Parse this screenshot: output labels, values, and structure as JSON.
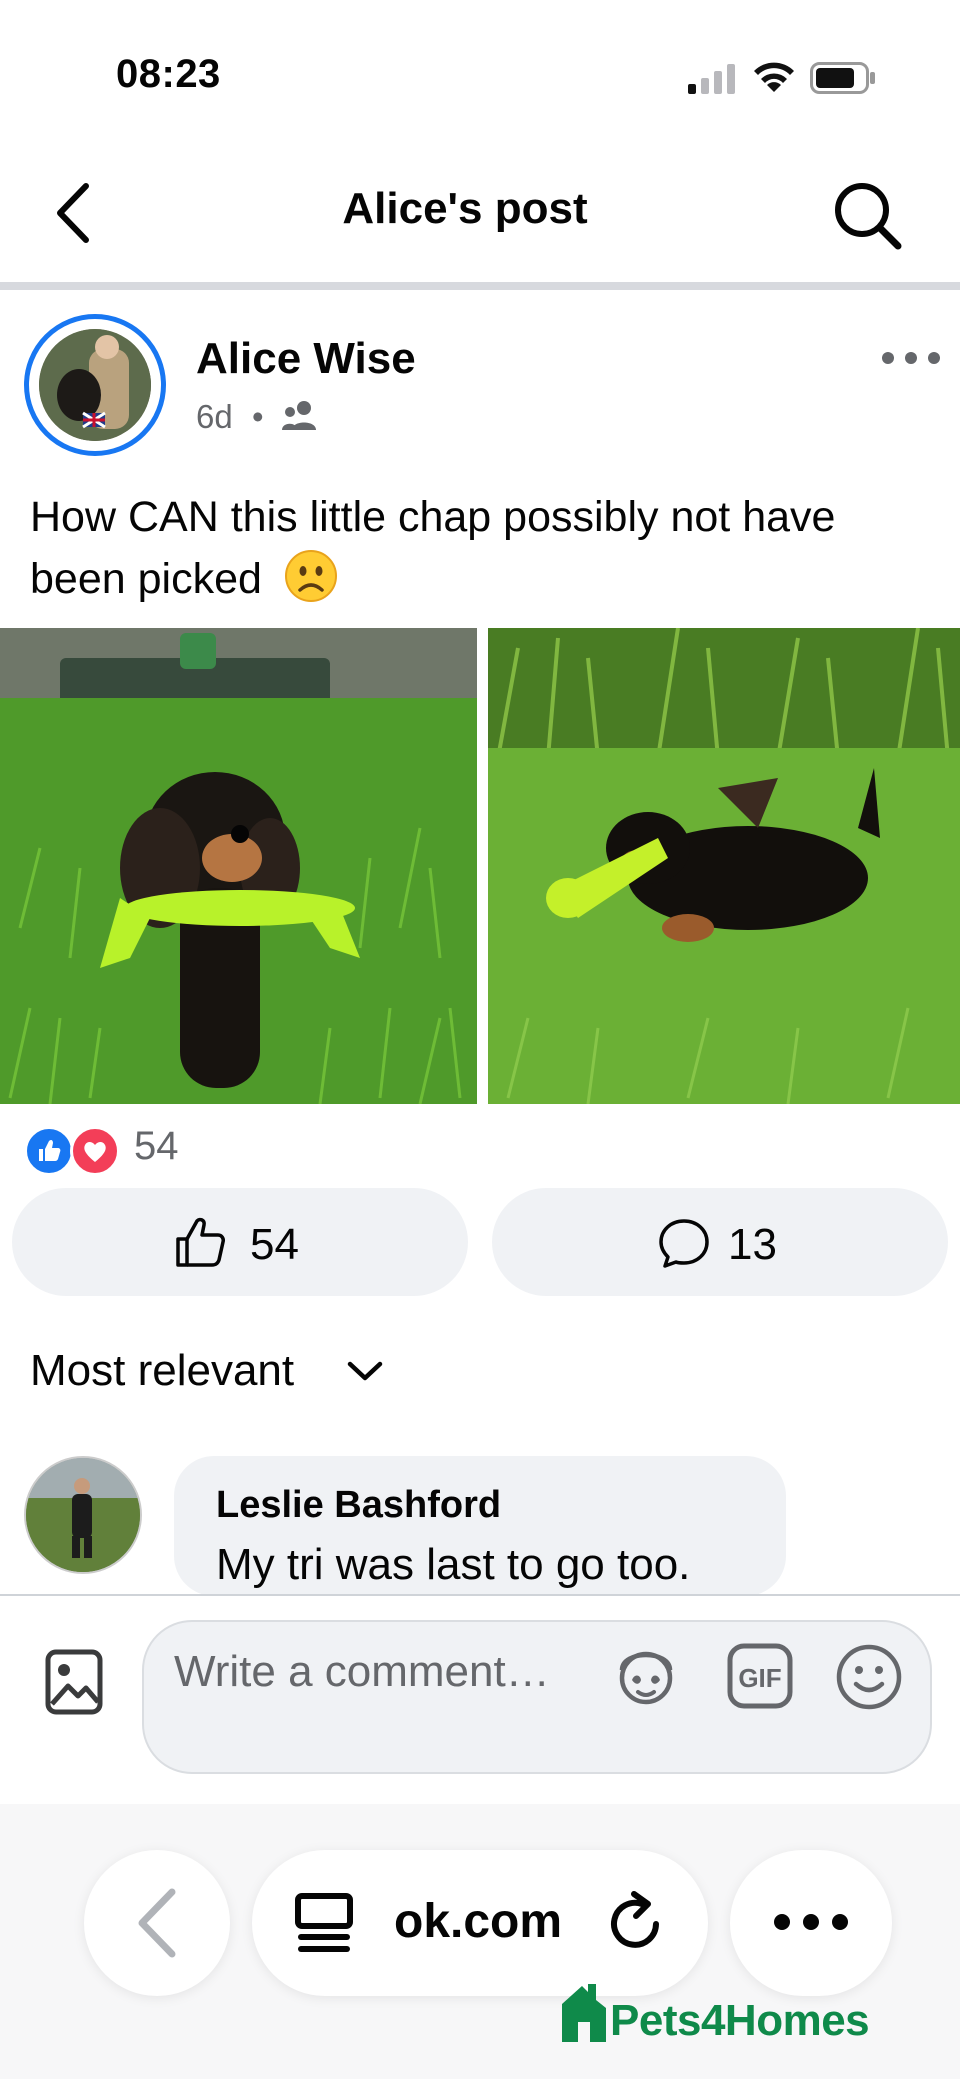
{
  "status_bar": {
    "time": "08:23"
  },
  "nav": {
    "title": "Alice's post"
  },
  "post": {
    "author": "Alice Wise",
    "time": "6d",
    "separator": "•",
    "text": "How CAN this little chap possibly not have been picked",
    "emoji": "☹️",
    "reaction_count": "54",
    "like_count": "54",
    "comment_count": "13"
  },
  "comments": {
    "sort_label": "Most relevant",
    "items": [
      {
        "author": "Leslie Bashford",
        "text": "My tri was last to go too."
      }
    ]
  },
  "composer": {
    "placeholder": "Write a comment…"
  },
  "browser": {
    "url": "ok.com"
  },
  "watermark": {
    "text": "Pets4Homes"
  },
  "colors": {
    "accent": "#1877f2",
    "love": "#f33e58",
    "pill_bg": "#f0f2f5",
    "watermark": "#0f8a4a"
  },
  "icons": [
    "back-icon",
    "search-icon",
    "audience-icon",
    "more-icon",
    "like-icon",
    "comment-icon",
    "chevron-down-icon",
    "image-icon",
    "avatar-sticker-icon",
    "gif-icon",
    "emoji-icon",
    "browser-back-icon",
    "tabs-icon",
    "reload-icon",
    "browser-more-icon"
  ]
}
